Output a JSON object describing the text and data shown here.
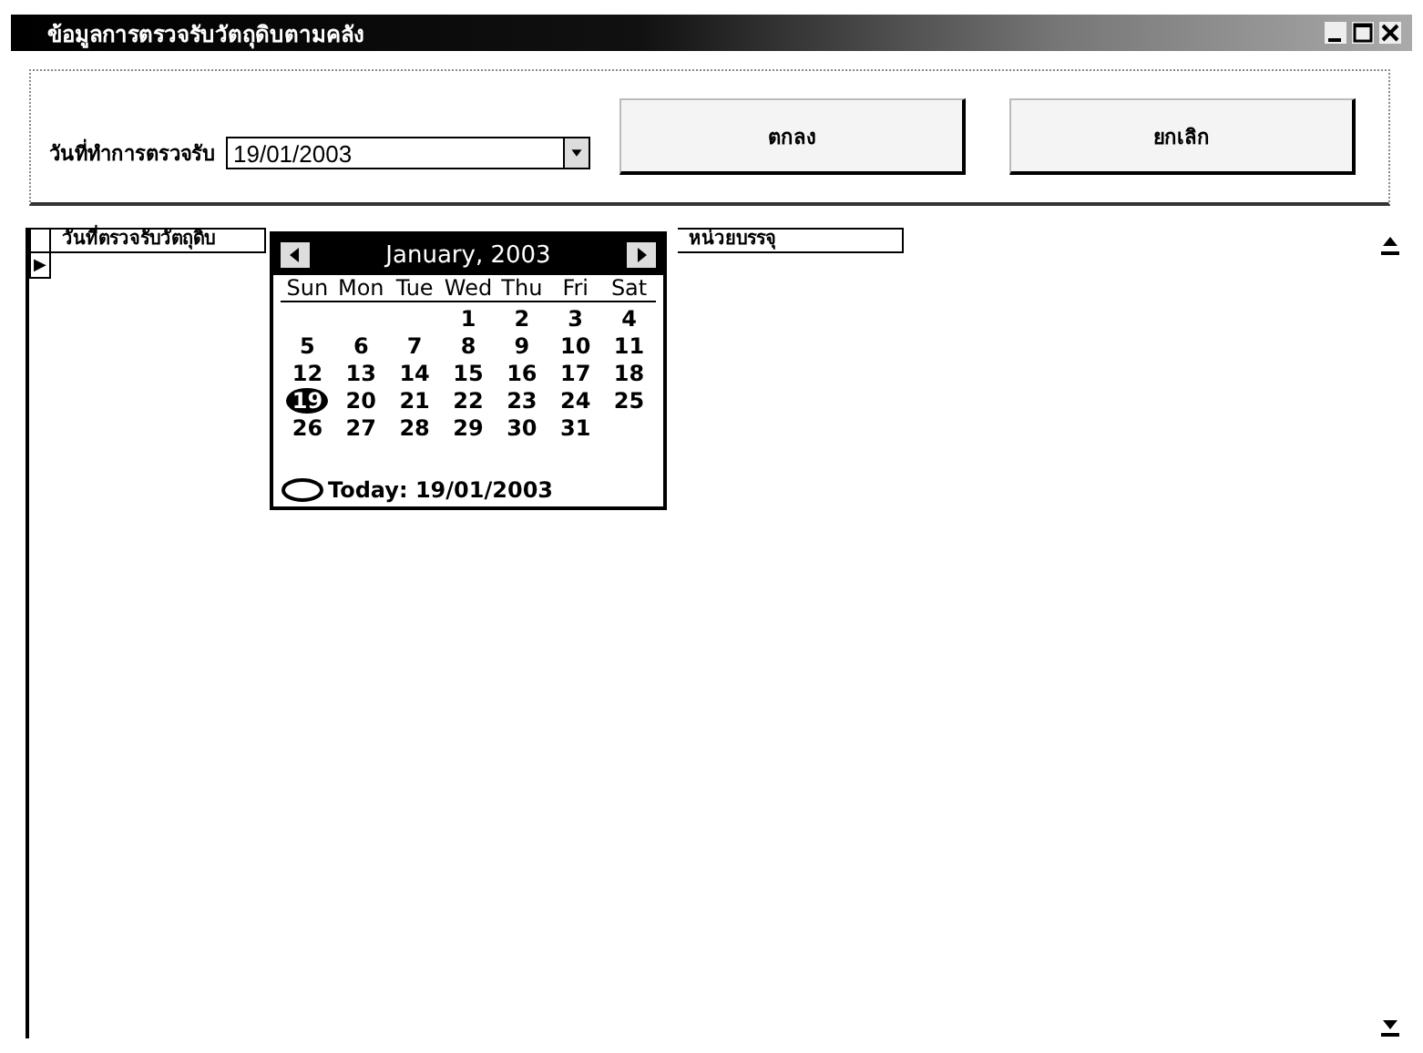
{
  "window": {
    "title": "ข้อมูลการตรวจรับวัตถุดิบตามคลัง"
  },
  "form": {
    "date_label": "วันที่ทำการตรวจรับ",
    "date_value": "19/01/2003",
    "buttons": [
      "ตกลง",
      "ยกเลิก"
    ]
  },
  "grid": {
    "columns": [
      "วันที่ตรวจรับวัตถุดิบ",
      "หน่วยบรรจุ"
    ],
    "row_marker": "▶"
  },
  "calendar": {
    "month": "January, 2003",
    "weekdays": [
      "Sun",
      "Mon",
      "Tue",
      "Wed",
      "Thu",
      "Fri",
      "Sat"
    ],
    "weeks": [
      [
        {
          "day": "1",
          "selected": false
        },
        {
          "day": "2",
          "selected": false
        },
        {
          "day": "3",
          "selected": false
        },
        {
          "day": "4",
          "selected": false
        }
      ],
      [
        {
          "day": "5",
          "selected": false
        },
        {
          "day": "6",
          "selected": false
        },
        {
          "day": "7",
          "selected": false
        },
        {
          "day": "8",
          "selected": false
        },
        {
          "day": "9",
          "selected": false
        },
        {
          "day": "10",
          "selected": false
        },
        {
          "day": "11",
          "selected": false
        }
      ],
      [
        {
          "day": "12",
          "selected": false
        },
        {
          "day": "13",
          "selected": false
        },
        {
          "day": "14",
          "selected": false
        },
        {
          "day": "15",
          "selected": false
        },
        {
          "day": "16",
          "selected": false
        },
        {
          "day": "17",
          "selected": false
        },
        {
          "day": "18",
          "selected": false
        }
      ],
      [
        {
          "day": "19",
          "selected": true
        },
        {
          "day": "20",
          "selected": false
        },
        {
          "day": "21",
          "selected": false
        },
        {
          "day": "22",
          "selected": false
        },
        {
          "day": "23",
          "selected": false
        },
        {
          "day": "24",
          "selected": false
        },
        {
          "day": "25",
          "selected": false
        }
      ],
      [
        {
          "day": "26",
          "selected": false
        },
        {
          "day": "27",
          "selected": false
        },
        {
          "day": "28",
          "selected": false
        },
        {
          "day": "29",
          "selected": false
        },
        {
          "day": "30",
          "selected": false
        },
        {
          "day": "31",
          "selected": false
        }
      ]
    ],
    "today": "Today: 19/01/2003"
  }
}
